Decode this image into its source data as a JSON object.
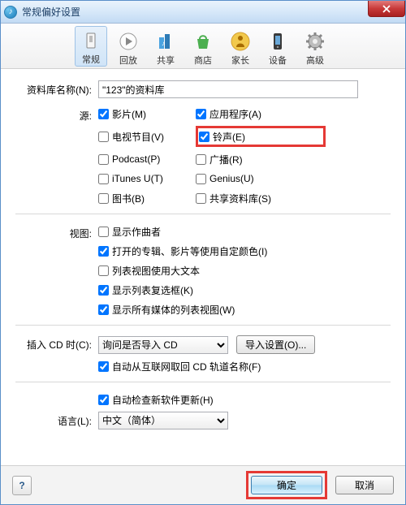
{
  "window": {
    "title": "常规偏好设置"
  },
  "toolbar": {
    "items": [
      {
        "label": "常规"
      },
      {
        "label": "回放"
      },
      {
        "label": "共享"
      },
      {
        "label": "商店"
      },
      {
        "label": "家长"
      },
      {
        "label": "设备"
      },
      {
        "label": "高级"
      }
    ]
  },
  "library": {
    "label": "资料库名称(N):",
    "value": "\"123\"的资料库"
  },
  "sources": {
    "label": "源:",
    "items": {
      "movies": {
        "label": "影片(M)",
        "checked": true
      },
      "apps": {
        "label": "应用程序(A)",
        "checked": true
      },
      "tv": {
        "label": "电视节目(V)",
        "checked": false
      },
      "ringtone": {
        "label": "铃声(E)",
        "checked": true
      },
      "podcast": {
        "label": "Podcast(P)",
        "checked": false
      },
      "radio": {
        "label": "广播(R)",
        "checked": false
      },
      "itunesu": {
        "label": "iTunes U(T)",
        "checked": false
      },
      "genius": {
        "label": "Genius(U)",
        "checked": false
      },
      "books": {
        "label": "图书(B)",
        "checked": false
      },
      "shared": {
        "label": "共享资料库(S)",
        "checked": false
      }
    }
  },
  "view": {
    "label": "视图:",
    "items": {
      "composer": {
        "label": "显示作曲者",
        "checked": false
      },
      "color": {
        "label": "打开的专辑、影片等使用自定颜色(I)",
        "checked": true
      },
      "bigtext": {
        "label": "列表视图使用大文本",
        "checked": false
      },
      "chklist": {
        "label": "显示列表复选框(K)",
        "checked": true
      },
      "alllist": {
        "label": "显示所有媒体的列表视图(W)",
        "checked": true
      }
    }
  },
  "cd": {
    "label": "插入 CD 时(C):",
    "select_value": "询问是否导入 CD",
    "settings_btn": "导入设置(O)...",
    "autotrack": {
      "label": "自动从互联网取回 CD 轨道名称(F)",
      "checked": true
    }
  },
  "update": {
    "label": "自动检查新软件更新(H)",
    "checked": true
  },
  "language": {
    "label": "语言(L):",
    "value": "中文（简体）"
  },
  "footer": {
    "help": "?",
    "ok": "确定",
    "cancel": "取消"
  }
}
